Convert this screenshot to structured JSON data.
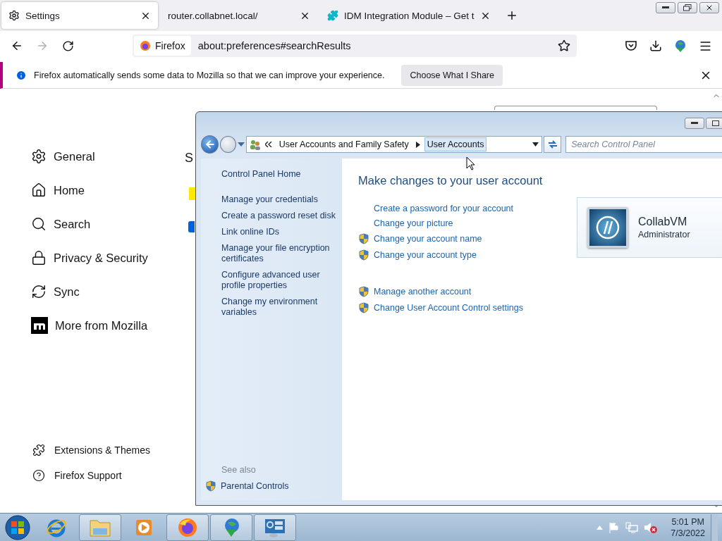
{
  "browser": {
    "tabs": [
      {
        "label": "Settings",
        "selected": true,
        "kind": "settings"
      },
      {
        "label": "router.collabnet.local/",
        "selected": false,
        "kind": "blank"
      },
      {
        "label": "IDM Integration Module – Get t",
        "selected": false,
        "kind": "puzzle"
      }
    ],
    "identity": "Firefox",
    "address": "about:preferences#searchResults",
    "notification": {
      "text": "Firefox automatically sends some data to Mozilla so that we can improve your experience.",
      "button": "Choose What I Share"
    }
  },
  "settings": {
    "nav": [
      {
        "label": "General",
        "kind": "gear"
      },
      {
        "label": "Home",
        "kind": "home"
      },
      {
        "label": "Search",
        "kind": "search"
      },
      {
        "label": "Privacy & Security",
        "kind": "lock"
      },
      {
        "label": "Sync",
        "kind": "sync"
      },
      {
        "label": "More from Mozilla",
        "kind": "mozilla"
      }
    ],
    "footer": [
      {
        "label": "Extensions & Themes",
        "kind": "puzzle"
      },
      {
        "label": "Firefox Support",
        "kind": "help"
      }
    ],
    "heading": "S",
    "checkbox": {
      "checked": true
    }
  },
  "control_panel": {
    "breadcrumb": [
      "User Accounts and Family Safety",
      "User Accounts"
    ],
    "search_placeholder": "Search Control Panel",
    "sidebar": {
      "home": "Control Panel Home",
      "links": [
        "Manage your credentials",
        "Create a password reset disk",
        "Link online IDs",
        "Manage your file encryption certificates",
        "Configure advanced user profile properties",
        "Change my environment variables"
      ],
      "see_also_label": "See also",
      "see_also": [
        {
          "label": "Parental Controls",
          "shield": true
        }
      ]
    },
    "heading": "Make changes to your user account",
    "task_groups": [
      [
        {
          "label": "Create a password for your account",
          "shield": false
        },
        {
          "label": "Change your picture",
          "shield": false
        },
        {
          "label": "Change your account name",
          "shield": true
        },
        {
          "label": "Change your account type",
          "shield": true
        }
      ],
      [
        {
          "label": "Manage another account",
          "shield": true
        },
        {
          "label": "Change User Account Control settings",
          "shield": true
        }
      ]
    ],
    "account": {
      "name": "CollabVM",
      "role": "Administrator"
    }
  },
  "taskbar": {
    "apps": [
      {
        "kind": "ie",
        "running": false
      },
      {
        "kind": "folder",
        "running": true
      },
      {
        "kind": "media",
        "running": false
      },
      {
        "kind": "firefox",
        "running": true
      },
      {
        "kind": "idm",
        "running": true
      },
      {
        "kind": "controlpanel",
        "running": true
      }
    ],
    "time": "5:01 PM",
    "date": "7/3/2022"
  }
}
